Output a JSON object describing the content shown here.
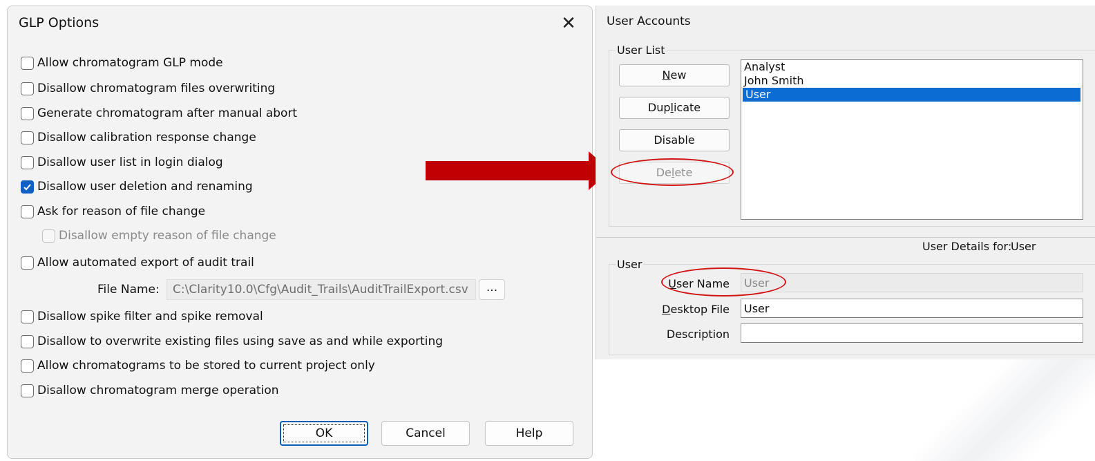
{
  "glp_dialog": {
    "title": "GLP Options",
    "close_symbol": "✕",
    "options": [
      {
        "label": "Allow chromatogram GLP mode",
        "checked": false,
        "enabled": true
      },
      {
        "label": "Disallow chromatogram files overwriting",
        "checked": false,
        "enabled": true
      },
      {
        "label": "Generate chromatogram after manual abort",
        "checked": false,
        "enabled": true
      },
      {
        "label": "Disallow calibration response change",
        "checked": false,
        "enabled": true
      },
      {
        "label": "Disallow user list in login dialog",
        "checked": false,
        "enabled": true
      },
      {
        "label": "Disallow user deletion and renaming",
        "checked": true,
        "enabled": true
      },
      {
        "label": "Ask for reason of file change",
        "checked": false,
        "enabled": true
      },
      {
        "label": "Disallow empty reason of file change",
        "checked": false,
        "enabled": false
      },
      {
        "label": "Allow automated export of audit trail",
        "checked": false,
        "enabled": true
      },
      {
        "label": "Disallow spike filter and spike removal",
        "checked": false,
        "enabled": true
      },
      {
        "label": "Disallow to overwrite existing files using save as and while exporting",
        "checked": false,
        "enabled": true
      },
      {
        "label": "Allow chromatograms to be stored to current project only",
        "checked": false,
        "enabled": true
      },
      {
        "label": "Disallow chromatogram merge operation",
        "checked": false,
        "enabled": true
      }
    ],
    "file_name_label": "File Name:",
    "file_name_value": "C:\\Clarity10.0\\Cfg\\Audit_Trails\\AuditTrailExport.csv",
    "browse_label": "...",
    "buttons": {
      "ok": "OK",
      "cancel": "Cancel",
      "help": "Help"
    }
  },
  "user_accounts": {
    "title": "User Accounts",
    "user_list_legend": "User List",
    "buttons": {
      "new": "New",
      "duplicate": "Duplicate",
      "disable": "Disable",
      "delete": "Delete"
    },
    "users": [
      "Analyst",
      "John Smith",
      "User"
    ],
    "selected_user": "User",
    "details_for_label": "User Details for:",
    "details_for_value": "User",
    "user_group_legend": "User",
    "fields": {
      "user_name_label": "User Name",
      "user_name_value": "User",
      "desktop_file_label": "Desktop File",
      "desktop_file_value": "User",
      "description_label": "Description",
      "description_value": ""
    }
  },
  "annotation": {
    "arrow_color": "#c00000",
    "highlight_color": "#d01414"
  },
  "colors": {
    "accent": "#0f5fc4",
    "selection": "#0b6cd4"
  }
}
